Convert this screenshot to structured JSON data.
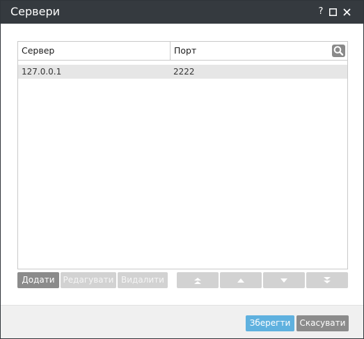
{
  "window": {
    "title": "Сервери",
    "help_glyph": "?",
    "maximize_glyph": "☐",
    "close_glyph": "✕"
  },
  "grid": {
    "columns": [
      "Сервер",
      "Порт"
    ],
    "rows": [
      {
        "server": "127.0.0.1",
        "port": "2222"
      }
    ],
    "selected_row": 0
  },
  "toolbar": {
    "add_label": "Додати",
    "edit_label": "Редагувати",
    "delete_label": "Видалити"
  },
  "footer": {
    "save_label": "Зберегти",
    "cancel_label": "Скасувати"
  },
  "icons": {
    "search": "search-icon",
    "move_top": "double-chevron-up-icon",
    "move_up": "triangle-up-icon",
    "move_down": "triangle-down-icon",
    "move_bottom": "double-chevron-down-icon"
  },
  "colors": {
    "titlebar": "#353a3f",
    "accent": "#5fb1df",
    "button_dark": "#8b8b8b",
    "button_disabled": "#d2d2d2",
    "selected_row": "#e6e6e6"
  }
}
